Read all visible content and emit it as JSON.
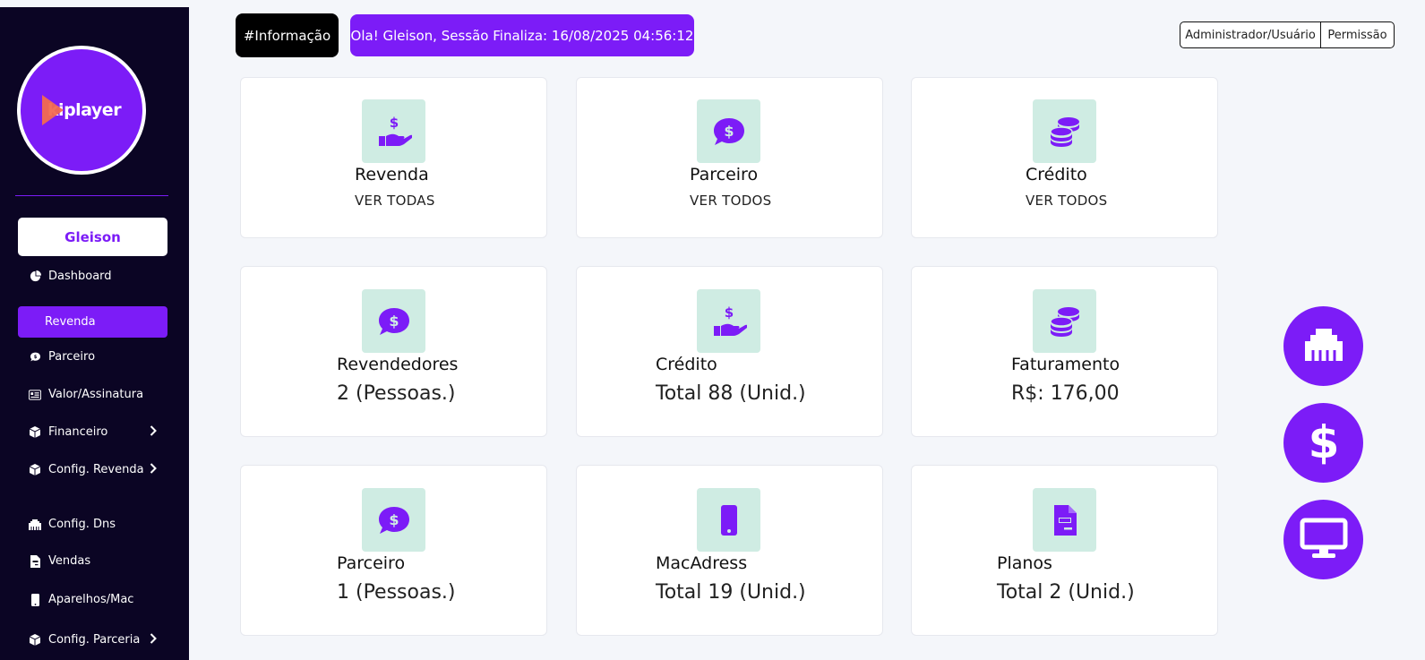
{
  "colors": {
    "accent": "#7c1cf7",
    "sidebar_bg": "#0b0524",
    "icon_bg": "#cfece3"
  },
  "logo": {
    "text": "kiplayer"
  },
  "user": {
    "name": "Gleison"
  },
  "nav": {
    "dashboard": "Dashboard",
    "revenda": "Revenda",
    "parceiro": "Parceiro",
    "valor": "Valor/Assinatura",
    "financeiro": "Financeiro",
    "config_revenda": "Config. Revenda",
    "config_dns": "Config. Dns",
    "vendas": "Vendas",
    "aparelhos": "Aparelhos/Mac",
    "config_parceria": "Config. Parceria"
  },
  "header": {
    "info": "#Informação",
    "session": "Ola! Gleison, Sessão Finaliza: 16/08/2025 04:56:12",
    "admin": "Administrador/Usuário",
    "permissao": "Permissão"
  },
  "cards": {
    "revenda": {
      "title": "Revenda",
      "link": "VER TODAS",
      "icon": "hand-dollar-icon"
    },
    "parceiro": {
      "title": "Parceiro",
      "link": "VER TODOS",
      "icon": "comment-dollar-icon"
    },
    "credito": {
      "title": "Crédito",
      "link": "VER TODOS",
      "icon": "coins-icon"
    },
    "revendedores": {
      "title": "Revendedores",
      "value": "2 (Pessoas.)",
      "icon": "comment-dollar-icon"
    },
    "credito_total": {
      "title": "Crédito",
      "value": "Total 88 (Unid.)",
      "icon": "hand-dollar-icon"
    },
    "faturamento": {
      "title": "Faturamento",
      "value": "R$: 176,00",
      "icon": "coins-icon"
    },
    "parceiro_total": {
      "title": "Parceiro",
      "value": "1 (Pessoas.)",
      "icon": "comment-dollar-icon"
    },
    "macadress": {
      "title": "MacAdress",
      "value": "Total 19 (Unid.)",
      "icon": "mobile-icon"
    },
    "planos": {
      "title": "Planos",
      "value": "Total 2 (Unid.)",
      "icon": "file-invoice-icon"
    }
  },
  "side_actions": [
    "ethernet-icon",
    "dollar-icon",
    "desktop-icon"
  ]
}
